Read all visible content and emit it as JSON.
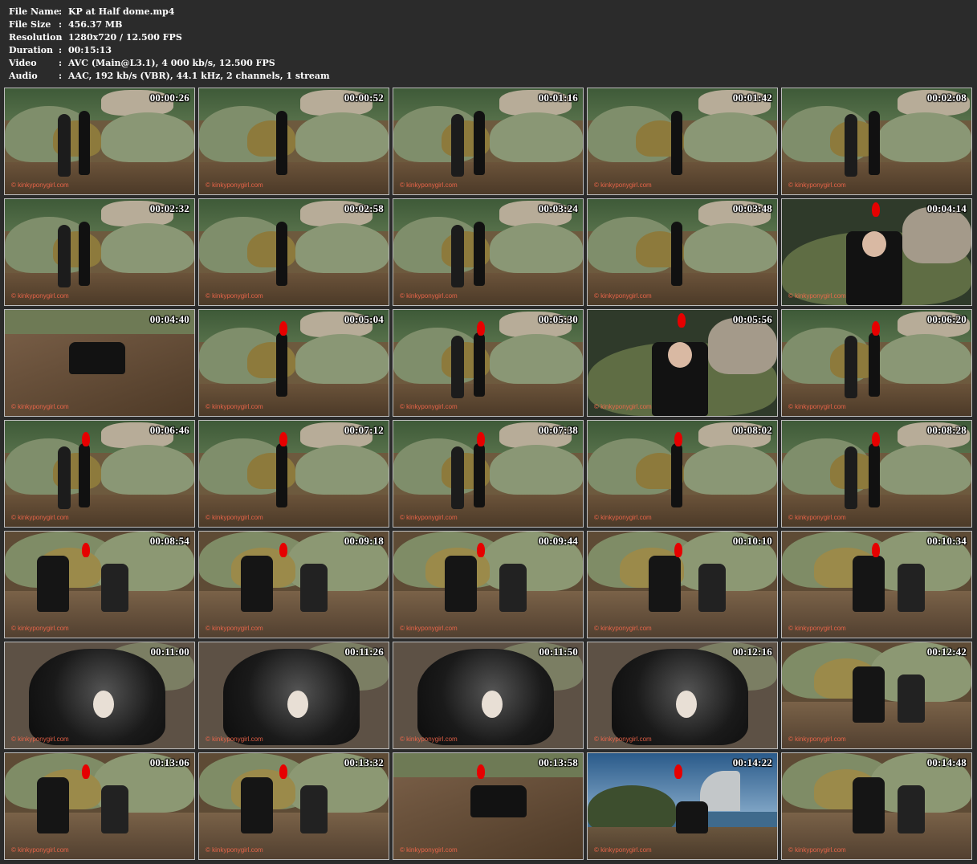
{
  "file_info": {
    "rows": [
      {
        "key": "File Name",
        "value": "KP at Half dome.mp4"
      },
      {
        "key": "File Size",
        "value": "456.37 MB"
      },
      {
        "key": "Resolution",
        "value": "1280x720 / 12.500 FPS"
      },
      {
        "key": "Duration",
        "value": "00:15:13"
      },
      {
        "key": "Video",
        "value": "AVC (Main@L3.1), 4 000 kb/s, 12.500 FPS"
      },
      {
        "key": "Audio",
        "value": "AAC, 192 kb/s (VBR), 44.1 kHz, 2 channels, 1 stream"
      }
    ],
    "separator": ":"
  },
  "thumbnails": [
    {
      "time": "00:00:26",
      "scene": "garden",
      "plume": false
    },
    {
      "time": "00:00:52",
      "scene": "garden",
      "plume": false
    },
    {
      "time": "00:01:16",
      "scene": "garden",
      "plume": false
    },
    {
      "time": "00:01:42",
      "scene": "garden",
      "plume": false
    },
    {
      "time": "00:02:08",
      "scene": "garden",
      "plume": false
    },
    {
      "time": "00:02:32",
      "scene": "garden",
      "plume": false
    },
    {
      "time": "00:02:58",
      "scene": "garden",
      "plume": false
    },
    {
      "time": "00:03:24",
      "scene": "garden",
      "plume": false
    },
    {
      "time": "00:03:48",
      "scene": "garden",
      "plume": false
    },
    {
      "time": "00:04:14",
      "scene": "closeup",
      "plume": true
    },
    {
      "time": "00:04:40",
      "scene": "ground",
      "plume": false
    },
    {
      "time": "00:05:04",
      "scene": "garden",
      "plume": true
    },
    {
      "time": "00:05:30",
      "scene": "garden",
      "plume": true
    },
    {
      "time": "00:05:56",
      "scene": "closeup",
      "plume": true
    },
    {
      "time": "00:06:20",
      "scene": "garden",
      "plume": true
    },
    {
      "time": "00:06:46",
      "scene": "garden",
      "plume": true
    },
    {
      "time": "00:07:12",
      "scene": "garden",
      "plume": true
    },
    {
      "time": "00:07:38",
      "scene": "garden",
      "plume": true
    },
    {
      "time": "00:08:02",
      "scene": "garden",
      "plume": true
    },
    {
      "time": "00:08:28",
      "scene": "garden",
      "plume": true
    },
    {
      "time": "00:08:54",
      "scene": "bush",
      "plume": true
    },
    {
      "time": "00:09:18",
      "scene": "bush",
      "plume": true
    },
    {
      "time": "00:09:44",
      "scene": "bush",
      "plume": true
    },
    {
      "time": "00:10:10",
      "scene": "bush",
      "plume": true
    },
    {
      "time": "00:10:34",
      "scene": "bush",
      "plume": true
    },
    {
      "time": "00:11:00",
      "scene": "closeup-dark",
      "plume": false
    },
    {
      "time": "00:11:26",
      "scene": "closeup-dark",
      "plume": false
    },
    {
      "time": "00:11:50",
      "scene": "closeup-dark",
      "plume": false
    },
    {
      "time": "00:12:16",
      "scene": "closeup-dark",
      "plume": false
    },
    {
      "time": "00:12:42",
      "scene": "bush",
      "plume": false
    },
    {
      "time": "00:13:06",
      "scene": "bush",
      "plume": true
    },
    {
      "time": "00:13:32",
      "scene": "bush",
      "plume": true
    },
    {
      "time": "00:13:58",
      "scene": "ground",
      "plume": true
    },
    {
      "time": "00:14:22",
      "scene": "vista",
      "plume": true
    },
    {
      "time": "00:14:48",
      "scene": "bush",
      "plume": false
    }
  ],
  "watermark": "© kinkyponygirl.com",
  "colors": {
    "background": "#2b2b2b",
    "thumb_border": "#bdbdbd",
    "timecode": "#ffffff",
    "plume": "#e60000"
  }
}
